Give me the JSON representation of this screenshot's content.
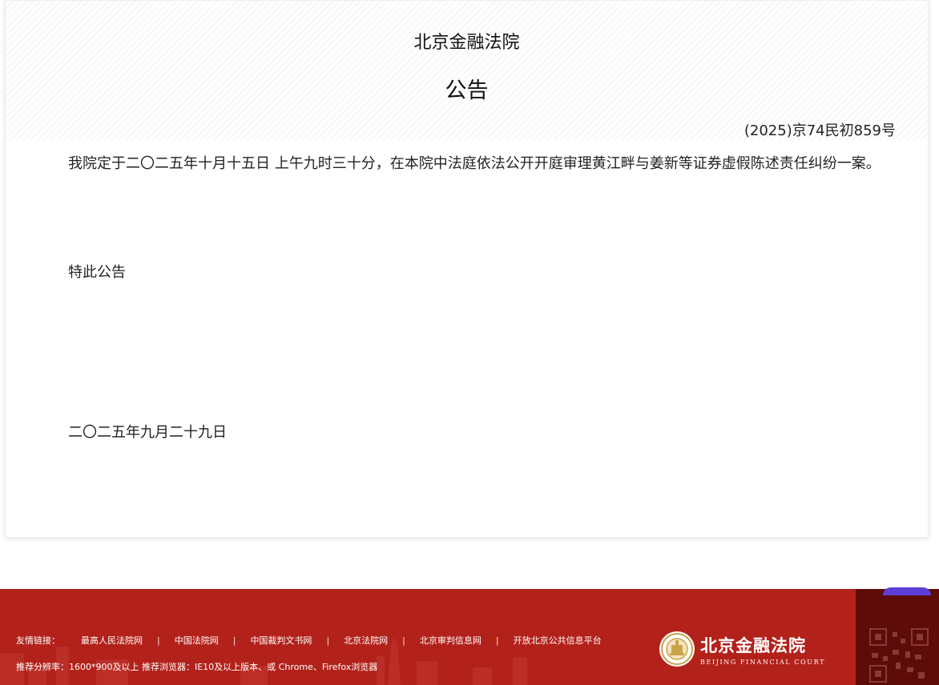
{
  "notice": {
    "court_name": "北京金融法院",
    "doc_title": "公告",
    "case_number": "(2025)京74民初859号",
    "body_paragraph": "我院定于二〇二五年十月十五日 上午九时三十分，在本院中法庭依法公开开庭审理黄江畔与姜新等证券虚假陈述责任纠纷一案。",
    "closing": "特此公告",
    "date": "二〇二五年九月二十九日"
  },
  "footer": {
    "links_label": "友情链接：",
    "links": [
      "最高人民法院网",
      "中国法院网",
      "中国裁判文书网",
      "北京法院网",
      "北京审判信息网",
      "开放北京公共信息平台"
    ],
    "separator": "|",
    "recommendation": "推荐分辨率：1600*900及以上 推荐浏览器：IE10及以上版本、或 Chrome、Firefox浏览器",
    "logo_cn": "北京金融法院",
    "logo_en": "BEIJING FINANCIAL COURT"
  },
  "colors": {
    "footer_red": "#b3211b",
    "qr_panel": "#5e0c0a"
  },
  "icons": [
    "court-seal-icon",
    "qr-code-icon"
  ]
}
